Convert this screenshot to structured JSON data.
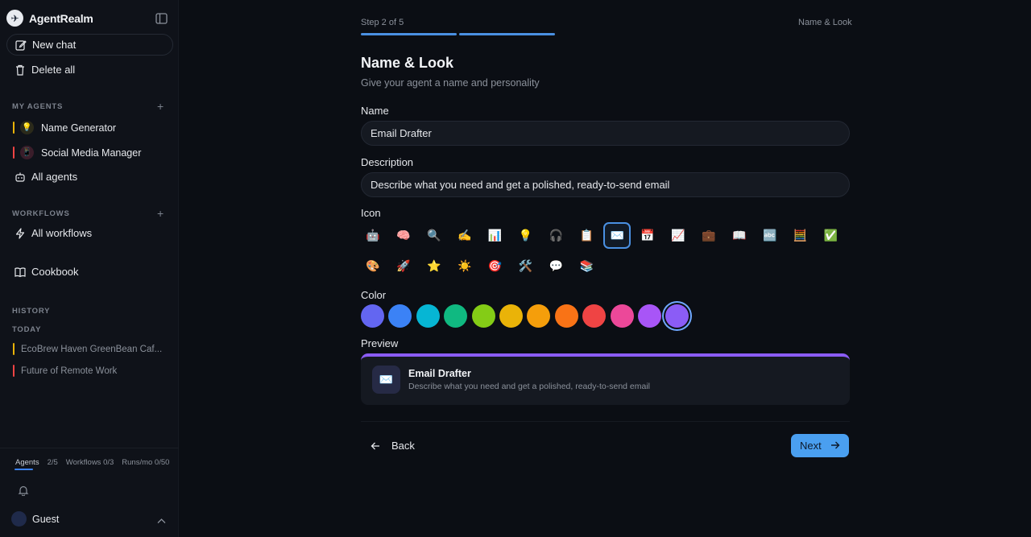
{
  "sidebar": {
    "brand": "AgentRealm",
    "new_chat": "New chat",
    "delete_all": "Delete all",
    "my_agents_label": "MY AGENTS",
    "agents": [
      {
        "name": "Name Generator",
        "emoji": "💡",
        "bar_color": "#eab308",
        "bg": "#2b2a1a"
      },
      {
        "name": "Social Media Manager",
        "emoji": "📱",
        "bar_color": "#ef4444",
        "bg": "#3a1d2a"
      }
    ],
    "all_agents": "All agents",
    "workflows_label": "WORKFLOWS",
    "all_workflows": "All workflows",
    "cookbook": "Cookbook",
    "history_label": "HISTORY",
    "today_label": "TODAY",
    "history": [
      {
        "title": "EcoBrew Haven GreenBean Caf...",
        "bar_color": "#eab308"
      },
      {
        "title": "Future of Remote Work",
        "bar_color": "#ef4444"
      }
    ],
    "usage": {
      "agents_label": "Agents",
      "agents_count": "2/5",
      "workflows": "Workflows 0/3",
      "runs": "Runs/mo 0/50"
    },
    "user": "Guest"
  },
  "wizard": {
    "step_text": "Step 2 of 5",
    "step_name": "Name & Look",
    "progress_steps_done": 2,
    "progress_steps_total": 5,
    "title": "Name & Look",
    "subtitle": "Give your agent a name and personality",
    "name_label": "Name",
    "name_value": "Email Drafter",
    "description_label": "Description",
    "description_value": "Describe what you need and get a polished, ready-to-send email",
    "icon_label": "Icon",
    "icons": [
      "🤖",
      "🧠",
      "🔍",
      "✍️",
      "📊",
      "💡",
      "🎧",
      "📋",
      "✉️",
      "📅",
      "📈",
      "💼",
      "📖",
      "🔤",
      "🧮",
      "✅",
      "🎨",
      "🚀",
      "⭐",
      "☀️",
      "🎯",
      "🛠️",
      "💬",
      "📚"
    ],
    "selected_icon_index": 8,
    "color_label": "Color",
    "colors": [
      "#6366f1",
      "#3b82f6",
      "#06b6d4",
      "#10b981",
      "#84cc16",
      "#eab308",
      "#f59e0b",
      "#f97316",
      "#ef4444",
      "#ec4899",
      "#a855f7",
      "#8b5cf6"
    ],
    "selected_color_index": 11,
    "preview_label": "Preview",
    "preview": {
      "icon": "✉️",
      "name": "Email Drafter",
      "description": "Describe what you need and get a polished, ready-to-send email"
    },
    "back_label": "Back",
    "next_label": "Next"
  }
}
